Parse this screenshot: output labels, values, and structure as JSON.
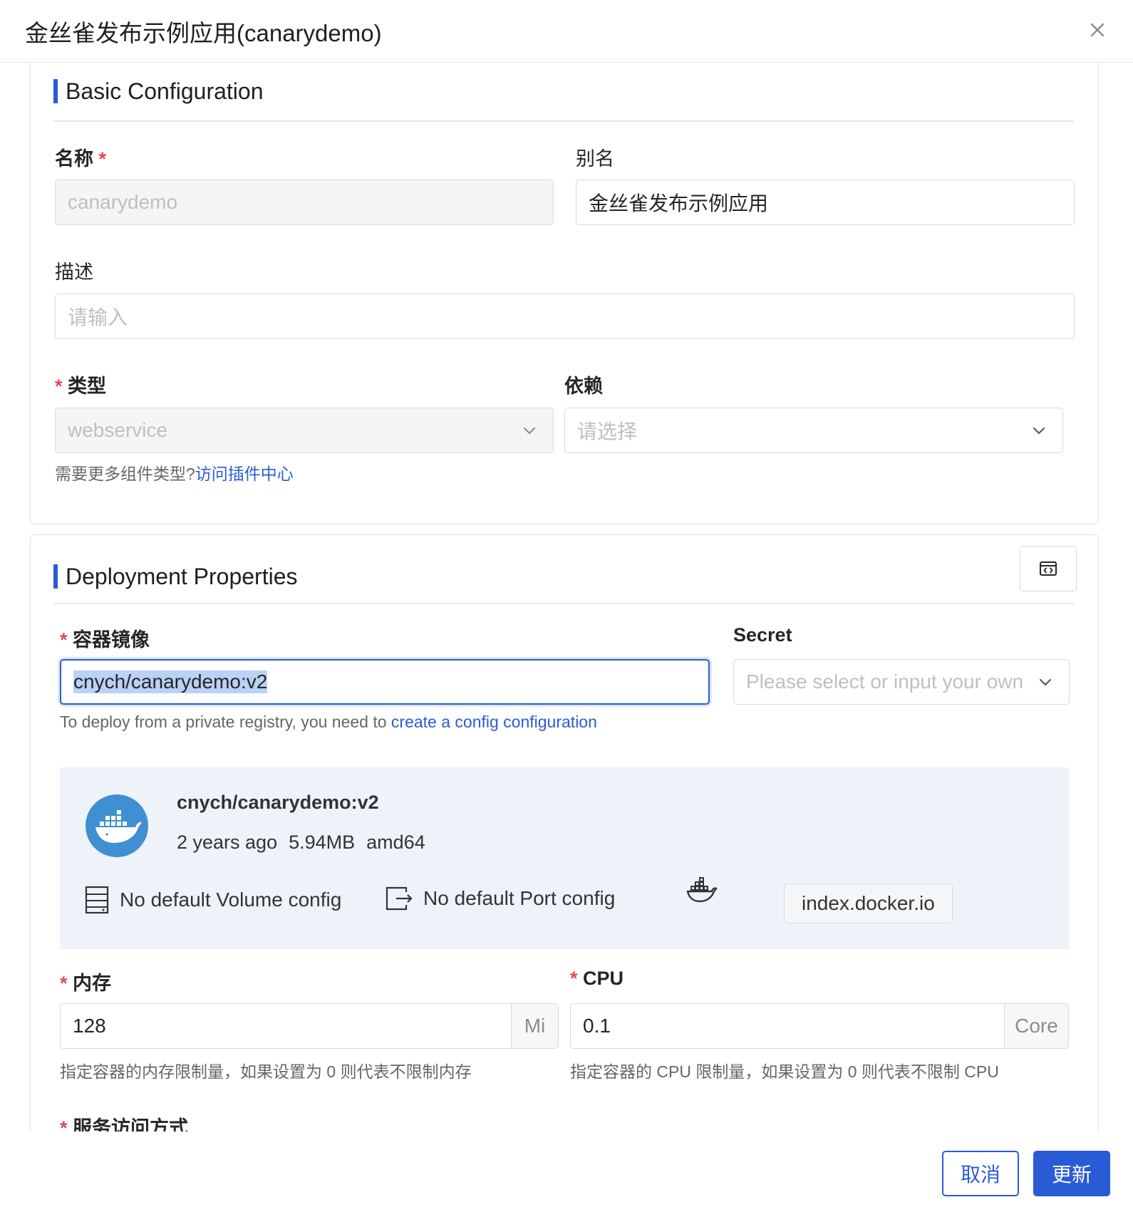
{
  "dialog": {
    "title": "金丝雀发布示例应用(canarydemo)"
  },
  "basic": {
    "section_title": "Basic Configuration",
    "name_label": "名称",
    "name_value": "canarydemo",
    "alias_label": "别名",
    "alias_value": "金丝雀发布示例应用",
    "desc_label": "描述",
    "desc_placeholder": "请输入",
    "type_label": "类型",
    "type_value": "webservice",
    "depends_label": "依赖",
    "depends_placeholder": "请选择",
    "hint_text": "需要更多组件类型?",
    "hint_link": "访问插件中心"
  },
  "deploy": {
    "section_title": "Deployment Properties",
    "image_label": "容器镜像",
    "image_value": "cnych/canarydemo:v2",
    "secret_label": "Secret",
    "secret_placeholder": "Please select or input your owne",
    "registry_hint": "To deploy from a private registry, you need to",
    "registry_link": "create a config configuration",
    "image_info": {
      "name": "cnych/canarydemo:v2",
      "age": "2 years ago",
      "size": "5.94MB",
      "arch": "amd64",
      "volume_config": "No default Volume config",
      "port_config": "No default Port config",
      "registry": "index.docker.io"
    },
    "memory_label": "内存",
    "memory_value": "128",
    "memory_unit": "Mi",
    "memory_hint": "指定容器的内存限制量，如果设置为 0 则代表不限制内存",
    "cpu_label": "CPU",
    "cpu_value": "0.1",
    "cpu_unit": "Core",
    "cpu_hint": "指定容器的 CPU 限制量，如果设置为 0 则代表不限制 CPU",
    "service_label": "服务访问方式",
    "required_mark": "*"
  },
  "footer": {
    "cancel_label": "取消",
    "update_label": "更新"
  },
  "colors": {
    "accent": "#2a5bd7",
    "required": "#e5484d",
    "panel_bg": "#eef3fa",
    "docker_blue": "#3f8fd2"
  }
}
